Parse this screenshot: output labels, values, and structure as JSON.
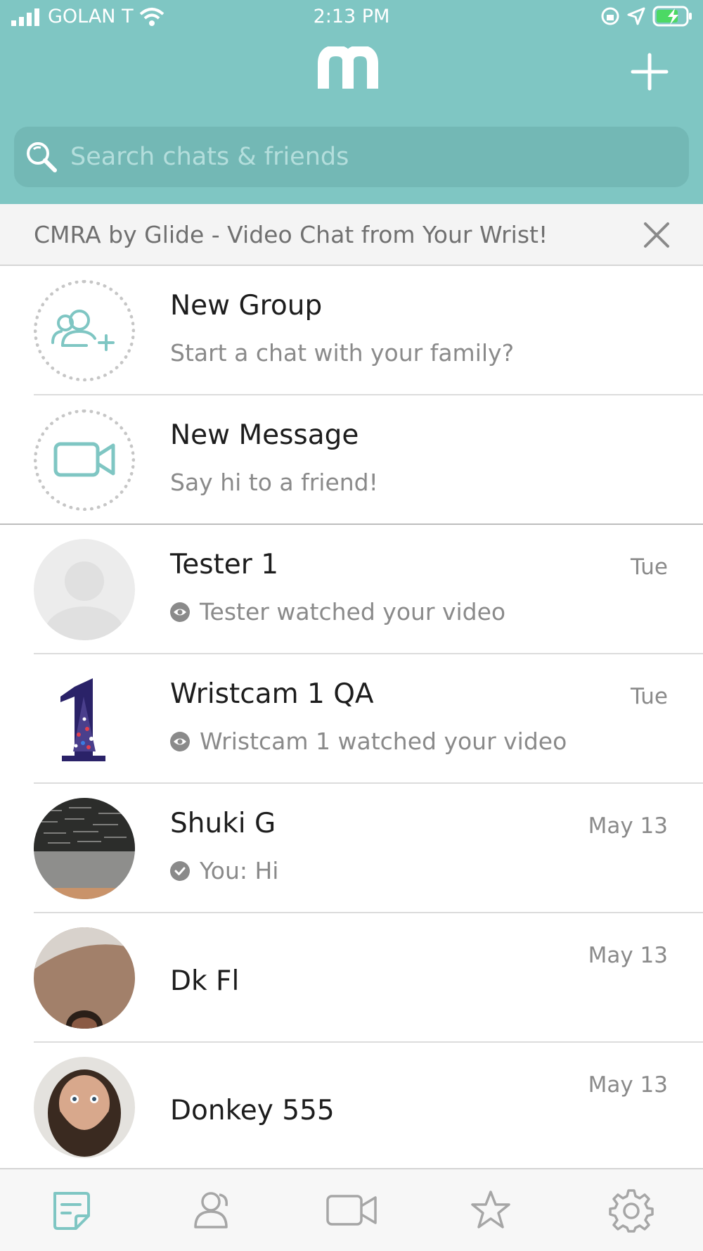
{
  "status_bar": {
    "carrier": "GOLAN T",
    "time": "2:13 PM"
  },
  "header": {
    "logo_text": "m"
  },
  "search": {
    "placeholder": "Search chats & friends"
  },
  "banner": {
    "text": "CMRA by Glide - Video Chat from Your Wrist!"
  },
  "actions": [
    {
      "title": "New Group",
      "subtitle": "Start a chat with your family?",
      "icon": "add-group-icon"
    },
    {
      "title": "New Message",
      "subtitle": "Say hi to a friend!",
      "icon": "video-camera-icon"
    }
  ],
  "chats": [
    {
      "name": "Tester 1",
      "date": "Tue",
      "preview": "Tester watched your video",
      "status_icon": "eye-icon"
    },
    {
      "name": "Wristcam 1 QA",
      "date": "Tue",
      "preview": "Wristcam 1 watched your video",
      "status_icon": "eye-icon"
    },
    {
      "name": "Shuki G",
      "date": "May 13",
      "preview": "You: Hi",
      "status_icon": "check-icon"
    },
    {
      "name": "Dk Fl",
      "date": "May 13",
      "preview": ""
    },
    {
      "name": "Donkey 555",
      "date": "May 13",
      "preview": ""
    }
  ],
  "tabbar": {
    "items": [
      "chats-icon",
      "friends-icon",
      "camera-icon",
      "favorites-icon",
      "settings-icon"
    ],
    "active": "chats-icon"
  },
  "colors": {
    "accent": "#7fc6c3",
    "search_bg": "#73b8b5",
    "tab_active": "#7fc6c3",
    "tab_inactive": "#a6a6a6"
  }
}
